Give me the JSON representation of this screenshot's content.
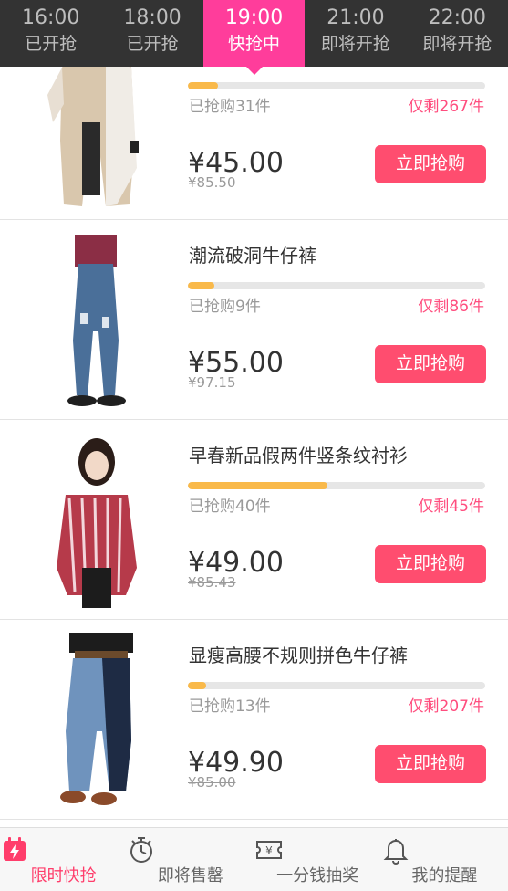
{
  "time_tabs": [
    {
      "time": "16:00",
      "status": "已开抢"
    },
    {
      "time": "18:00",
      "status": "已开抢"
    },
    {
      "time": "19:00",
      "status": "快抢中"
    },
    {
      "time": "21:00",
      "status": "即将开抢"
    },
    {
      "time": "22:00",
      "status": "即将开抢"
    }
  ],
  "products": [
    {
      "title": "",
      "progress": 0.1,
      "sold": "已抢购31件",
      "remaining": "仅剩267件",
      "price": "¥45.00",
      "original_price": "¥85.50",
      "button": "立即抢购",
      "image": "beige-jacket-photo"
    },
    {
      "title": "潮流破洞牛仔裤",
      "progress": 0.09,
      "sold": "已抢购9件",
      "remaining": "仅剩86件",
      "price": "¥55.00",
      "original_price": "¥97.15",
      "button": "立即抢购",
      "image": "ripped-jeans-photo"
    },
    {
      "title": "早春新品假两件竖条纹衬衫",
      "progress": 0.47,
      "sold": "已抢购40件",
      "remaining": "仅剩45件",
      "price": "¥49.00",
      "original_price": "¥85.43",
      "button": "立即抢购",
      "image": "striped-shirt-photo"
    },
    {
      "title": "显瘦高腰不规则拼色牛仔裤",
      "progress": 0.06,
      "sold": "已抢购13件",
      "remaining": "仅剩207件",
      "price": "¥49.90",
      "original_price": "¥85.00",
      "button": "立即抢购",
      "image": "patchwork-jeans-photo"
    }
  ],
  "bottom_nav": [
    {
      "label": "限时快抢",
      "icon": "flash-sale-icon"
    },
    {
      "label": "即将售罄",
      "icon": "timer-icon"
    },
    {
      "label": "一分钱抽奖",
      "icon": "lottery-ticket-icon"
    },
    {
      "label": "我的提醒",
      "icon": "bell-icon"
    }
  ],
  "colors": {
    "accent": "#ff3d9b",
    "buy_button": "#ff4d6f",
    "progress": "#f9b94a",
    "remaining_text": "#ff4d7e",
    "timebar_bg": "#333333"
  }
}
